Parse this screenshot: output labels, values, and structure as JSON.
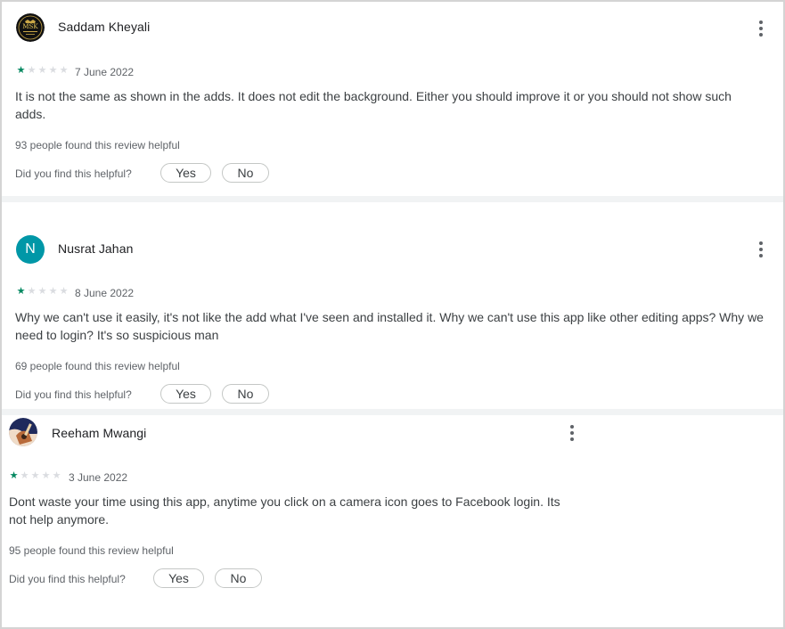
{
  "reviews": [
    {
      "author": "Saddam Kheyali",
      "avatar_text": "MSK",
      "rating": 1,
      "rating_max": 5,
      "date": "7 June 2022",
      "body_line1": "It is not the same as shown in the adds. It does not edit the background. Either you should improve it or you should not show such",
      "body_line2": "adds.",
      "helpful_count": "93 people found this review helpful",
      "helpful_question": "Did you find this helpful?",
      "yes_label": "Yes",
      "no_label": "No",
      "more_icon": "more-vert-icon"
    },
    {
      "author": "Nusrat Jahan",
      "avatar_letter": "N",
      "avatar_color": "#0097a7",
      "rating": 1,
      "rating_max": 5,
      "date": "8 June 2022",
      "body_line1": "Why we can't use it easily, it's not like the add what I've seen and installed it. Why we can't use this app like other editing apps? Why we",
      "body_line2": "need to login? It's so suspicious man",
      "helpful_count": "69 people found this review helpful",
      "helpful_question": "Did you find this helpful?",
      "yes_label": "Yes",
      "no_label": "No",
      "more_icon": "more-vert-icon"
    },
    {
      "author": "Reeham Mwangi",
      "rating": 1,
      "rating_max": 5,
      "date": "3 June 2022",
      "body_line1": "Dont waste your time using this app, anytime you click on a camera icon goes to Facebook login. Its",
      "body_line2": "not help anymore.",
      "helpful_count": "95 people found this review helpful",
      "helpful_question": "Did you find this helpful?",
      "yes_label": "Yes",
      "no_label": "No",
      "more_icon": "more-vert-icon"
    }
  ],
  "colors": {
    "star_filled": "#01875f",
    "star_empty": "#dadce0",
    "separator": "#f1f3f4"
  }
}
